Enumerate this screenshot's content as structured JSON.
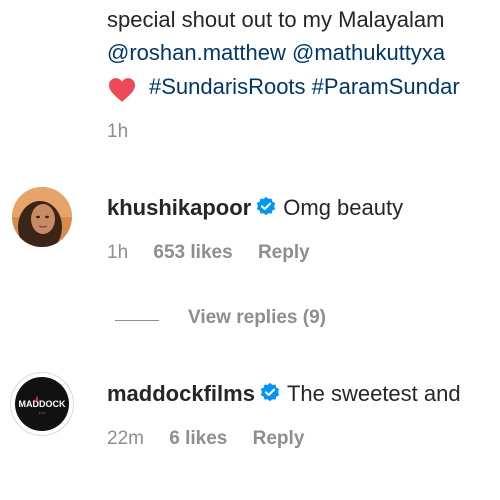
{
  "caption": {
    "line1": "special shout out to my Malayalam",
    "mentions": [
      "@roshan.matthew",
      "@mathukuttyxa"
    ],
    "hashtags": [
      "#SundarisRoots",
      "#ParamSundar"
    ],
    "heart_icon": "heart-icon",
    "time": "1h"
  },
  "comments": [
    {
      "username": "khushikapoor",
      "verified": true,
      "text": "Omg beauty",
      "time": "1h",
      "likes": "653 likes",
      "reply": "Reply",
      "view_replies": "View replies (9)"
    },
    {
      "username": "maddockfilms",
      "verified": true,
      "text": "The sweetest and",
      "time": "22m",
      "likes": "6 likes",
      "reply": "Reply",
      "avatar_logo_text": "MADDOCK"
    }
  ],
  "colors": {
    "link": "#00376b",
    "verified": "#0095f6",
    "heart": "#ed4956",
    "meta": "#8e8e8e"
  }
}
